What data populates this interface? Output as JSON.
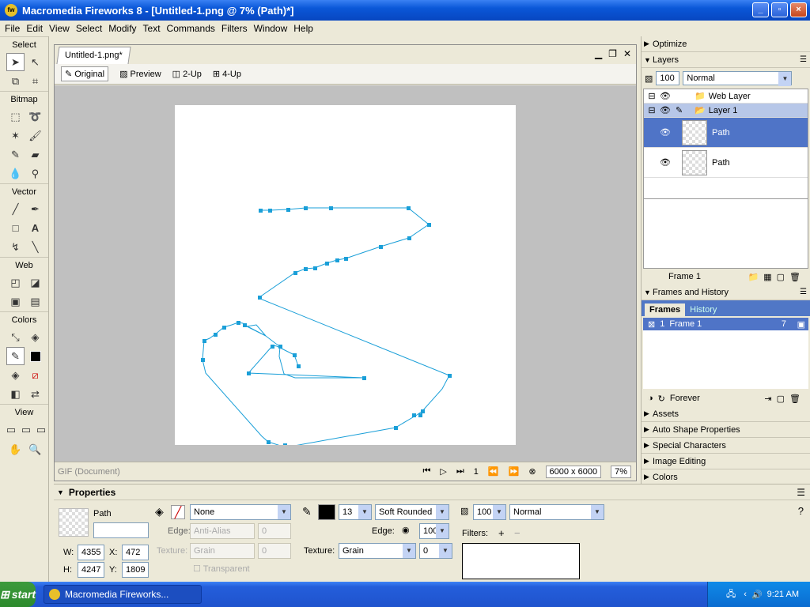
{
  "window": {
    "title": "Macromedia Fireworks 8 - [Untitled-1.png @  7% (Path)*]",
    "min": "_",
    "max": "▫",
    "close": "×"
  },
  "menu": [
    "File",
    "Edit",
    "View",
    "Select",
    "Modify",
    "Text",
    "Commands",
    "Filters",
    "Window",
    "Help"
  ],
  "toolbox": {
    "select": "Select",
    "bitmap": "Bitmap",
    "vector": "Vector",
    "web": "Web",
    "colors": "Colors",
    "view": "View"
  },
  "document": {
    "tab": "Untitled-1.png*",
    "views": [
      "Original",
      "Preview",
      "2-Up",
      "4-Up"
    ],
    "status": {
      "format": "GIF (Document)",
      "frame": "1",
      "size": "6000 x 6000",
      "zoom": "7%"
    }
  },
  "panels": {
    "optimize": "Optimize",
    "layers": {
      "title": "Layers",
      "opacity": "100",
      "blend": "Normal",
      "web_layer": "Web Layer",
      "layer1": "Layer 1",
      "path1": "Path",
      "path2": "Path",
      "frame": "Frame 1"
    },
    "frames_history": {
      "title": "Frames and History",
      "tab_frames": "Frames",
      "tab_history": "History",
      "frame_num": "1",
      "frame_name": "Frame 1",
      "delay": "7",
      "loop": "Forever"
    },
    "assets": "Assets",
    "auto_shape": "Auto Shape Properties",
    "special_chars": "Special Characters",
    "image_editing": "Image Editing",
    "colors": "Colors"
  },
  "properties": {
    "title": "Properties",
    "object_type": "Path",
    "w": "4355",
    "h": "4247",
    "x": "472",
    "y": "1809",
    "fill": "None",
    "edge_label": "Edge:",
    "edge": "Anti-Alias",
    "edge_val": "0",
    "texture_label": "Texture:",
    "texture": "Grain",
    "texture_val": "0",
    "transparent": "Transparent",
    "stroke_size": "13",
    "stroke_type": "Soft Rounded",
    "stroke_edge_label": "Edge:",
    "stroke_edge": "100",
    "stroke_texture_label": "Texture:",
    "stroke_texture": "Grain",
    "stroke_texture_val": "0",
    "opacity": "100",
    "blend": "Normal",
    "filters_label": "Filters:",
    "w_label": "W:",
    "h_label": "H:",
    "x_label": "X:",
    "y_label": "Y:"
  },
  "taskbar": {
    "start": "start",
    "item": "Macromedia Fireworks...",
    "time": "9:21 AM"
  },
  "colors": {
    "path_stroke": "#1a9fd8",
    "selection": "#4f74c7"
  }
}
